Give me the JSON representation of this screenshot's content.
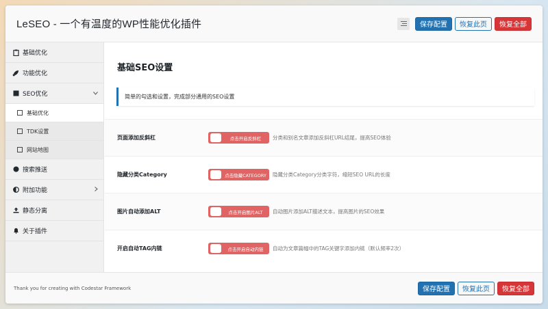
{
  "header": {
    "title": "LeSEO - 一个有温度的WP性能优化插件",
    "save_label": "保存配置",
    "reset_page_label": "恢复此页",
    "reset_all_label": "恢复全部"
  },
  "sidebar": {
    "items": [
      {
        "label": "基础优化",
        "icon": "clipboard-icon"
      },
      {
        "label": "功能优化",
        "icon": "rocket-icon"
      },
      {
        "label": "SEO优化",
        "icon": "square-icon"
      },
      {
        "label": "搜索推送",
        "icon": "circle-icon"
      },
      {
        "label": "附加功能",
        "icon": "half-circle-icon"
      },
      {
        "label": "静态分离",
        "icon": "upload-icon"
      },
      {
        "label": "关于插件",
        "icon": "bell-icon"
      }
    ],
    "sub_items": [
      {
        "label": "基础优化",
        "active": true
      },
      {
        "label": "TDK设置",
        "active": false
      },
      {
        "label": "网站地图",
        "active": false
      }
    ]
  },
  "main": {
    "section_title": "基础SEO设置",
    "notice": "简单的勾选和设置，完成部分通用的SEO设置",
    "rows": [
      {
        "label": "页面添加反斜杠",
        "toggle_text": "点击开启反斜杠",
        "description": "分类和别名文章添加反斜杠URL结尾，提高SEO体验"
      },
      {
        "label": "隐藏分类Category",
        "toggle_text": "点击隐藏CATEGORY",
        "description": "隐藏分类Category分类字符，缩短SEO URL的长度"
      },
      {
        "label": "图片自动添加ALT",
        "toggle_text": "点击开启图片ALT",
        "description": "自动图片添加ALT描述文本，提高图片的SEO效果"
      },
      {
        "label": "开启自动TAG内链",
        "toggle_text": "点击开启自动内链",
        "description": "自动为文章篇幅中的TAG关键字添加内链（默认频率2次）"
      }
    ]
  },
  "footer": {
    "credit": "Thank you for creating with Codestar Framework",
    "save_label": "保存配置",
    "reset_page_label": "恢复此页",
    "reset_all_label": "恢复全部"
  },
  "colors": {
    "primary": "#2271b1",
    "danger": "#d63638",
    "toggle_off": "#e06464"
  }
}
